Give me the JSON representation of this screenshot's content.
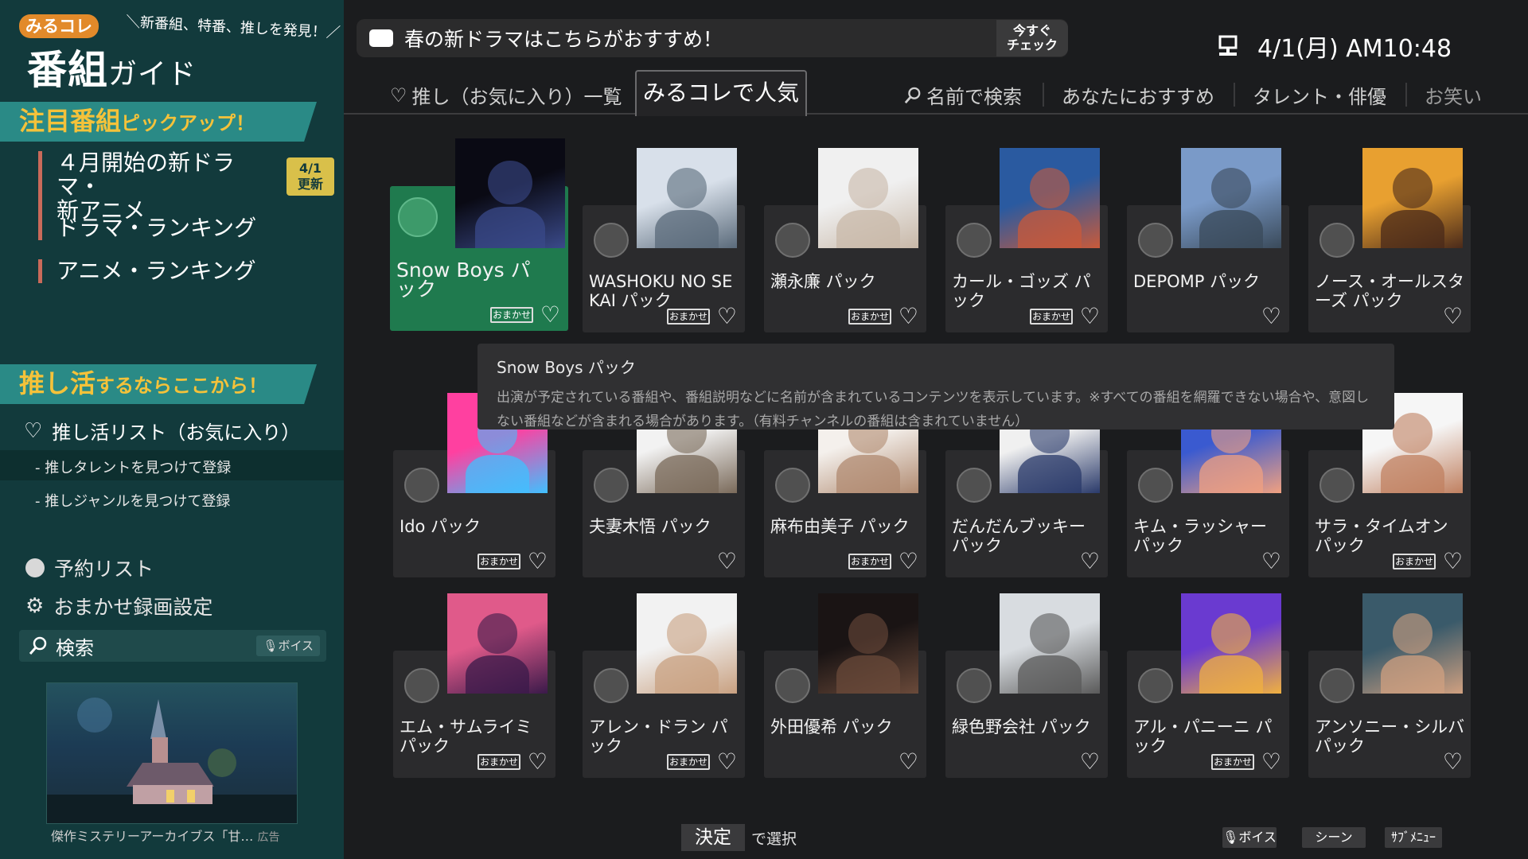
{
  "sidebar": {
    "logo_mini": "みるコレ",
    "logo_main": "番組",
    "logo_main_sub": "ガイド",
    "tagline": "＼新番組、特番、推しを発見！／",
    "featured_header": "注目番組",
    "featured_header_sub": "ピックアップ！",
    "nav_items": [
      {
        "label": "４月開始の新ドラマ・\n新アニメ",
        "badge": "4/1\n更新"
      },
      {
        "label": "ドラマ・ランキング"
      },
      {
        "label": "アニメ・ランキング"
      }
    ],
    "oshi_header": "推し活",
    "oshi_header_sub": "するならここから！",
    "oshi_list": "推し活リスト（お気に入り）",
    "oshi_sub_items": [
      "推しタレントを見つけて登録",
      "推しジャンルを見つけて登録"
    ],
    "menu_items": [
      "予約リスト",
      "おまかせ録画設定"
    ],
    "search_label": "検索",
    "voice_label": "ボイス",
    "ad_caption": "傑作ミステリーアーカイブス「甘…",
    "ad_label": "広告"
  },
  "topbar": {
    "message": "春の新ドラマはこちらがおすすめ！",
    "check_label": "今すぐ\nチェック",
    "datetime": "4/1(月) AM10:48"
  },
  "tabs": [
    {
      "label": "推し（お気に入り）一覧",
      "icon": "heart-icon"
    },
    {
      "label": "みるコレで人気",
      "active": true
    },
    {
      "label": "名前で検索",
      "icon": "search-icon"
    },
    {
      "label": "あなたにおすすめ"
    },
    {
      "label": "タレント・俳優"
    },
    {
      "label": "お笑い"
    }
  ],
  "cards": [
    {
      "name": "Snow Boys パック",
      "omakase": true,
      "selected": true
    },
    {
      "name": "WASHOKU NO SEKAI パック",
      "omakase": true
    },
    {
      "name": "瀬永廉 パック",
      "omakase": true
    },
    {
      "name": "カール・ゴッズ パック",
      "omakase": true
    },
    {
      "name": "DEPOMP パック",
      "omakase": false
    },
    {
      "name": "ノース・オールスターズ パック",
      "omakase": false
    },
    {
      "name": "Ido パック",
      "omakase": true
    },
    {
      "name": "夫妻木悟 パック",
      "omakase": false
    },
    {
      "name": "麻布由美子 パック",
      "omakase": true
    },
    {
      "name": "だんだんブッキー パック",
      "omakase": false
    },
    {
      "name": "キム・ラッシャー パック",
      "omakase": false
    },
    {
      "name": "サラ・タイムオン パック",
      "omakase": true
    },
    {
      "name": "エム・サムライミ パック",
      "omakase": true
    },
    {
      "name": "アレン・ドラン パック",
      "omakase": true
    },
    {
      "name": "外田優希 パック",
      "omakase": false
    },
    {
      "name": "緑色野会社 パック",
      "omakase": false
    },
    {
      "name": "アル・パニーニ パック",
      "omakase": true
    },
    {
      "name": "アンソニー・シルバ パック",
      "omakase": false
    }
  ],
  "omakase_label": "おまかせ",
  "tooltip": {
    "title": "Snow Boys パック",
    "body": "出演が予定されている番組や、番組説明などに名前が含まれているコンテンツを表示しています。※すべての番組を網羅できない場合や、意図しない番組などが含まれる場合があります。（有料チャンネルの番組は含まれていません）"
  },
  "bottombar": {
    "ok_key": "決定",
    "ok_label": "で選択",
    "voice": "ボイス",
    "scene": "シーン",
    "submenu": "ｻﾌﾞﾒﾆｭｰ"
  },
  "colors": {
    "sidebar_bg": "#123a3c",
    "section_header": "#2a8a86",
    "header_text": "#f4c23a",
    "selected_card": "#1f7a4e",
    "badge": "#d9c04a"
  }
}
